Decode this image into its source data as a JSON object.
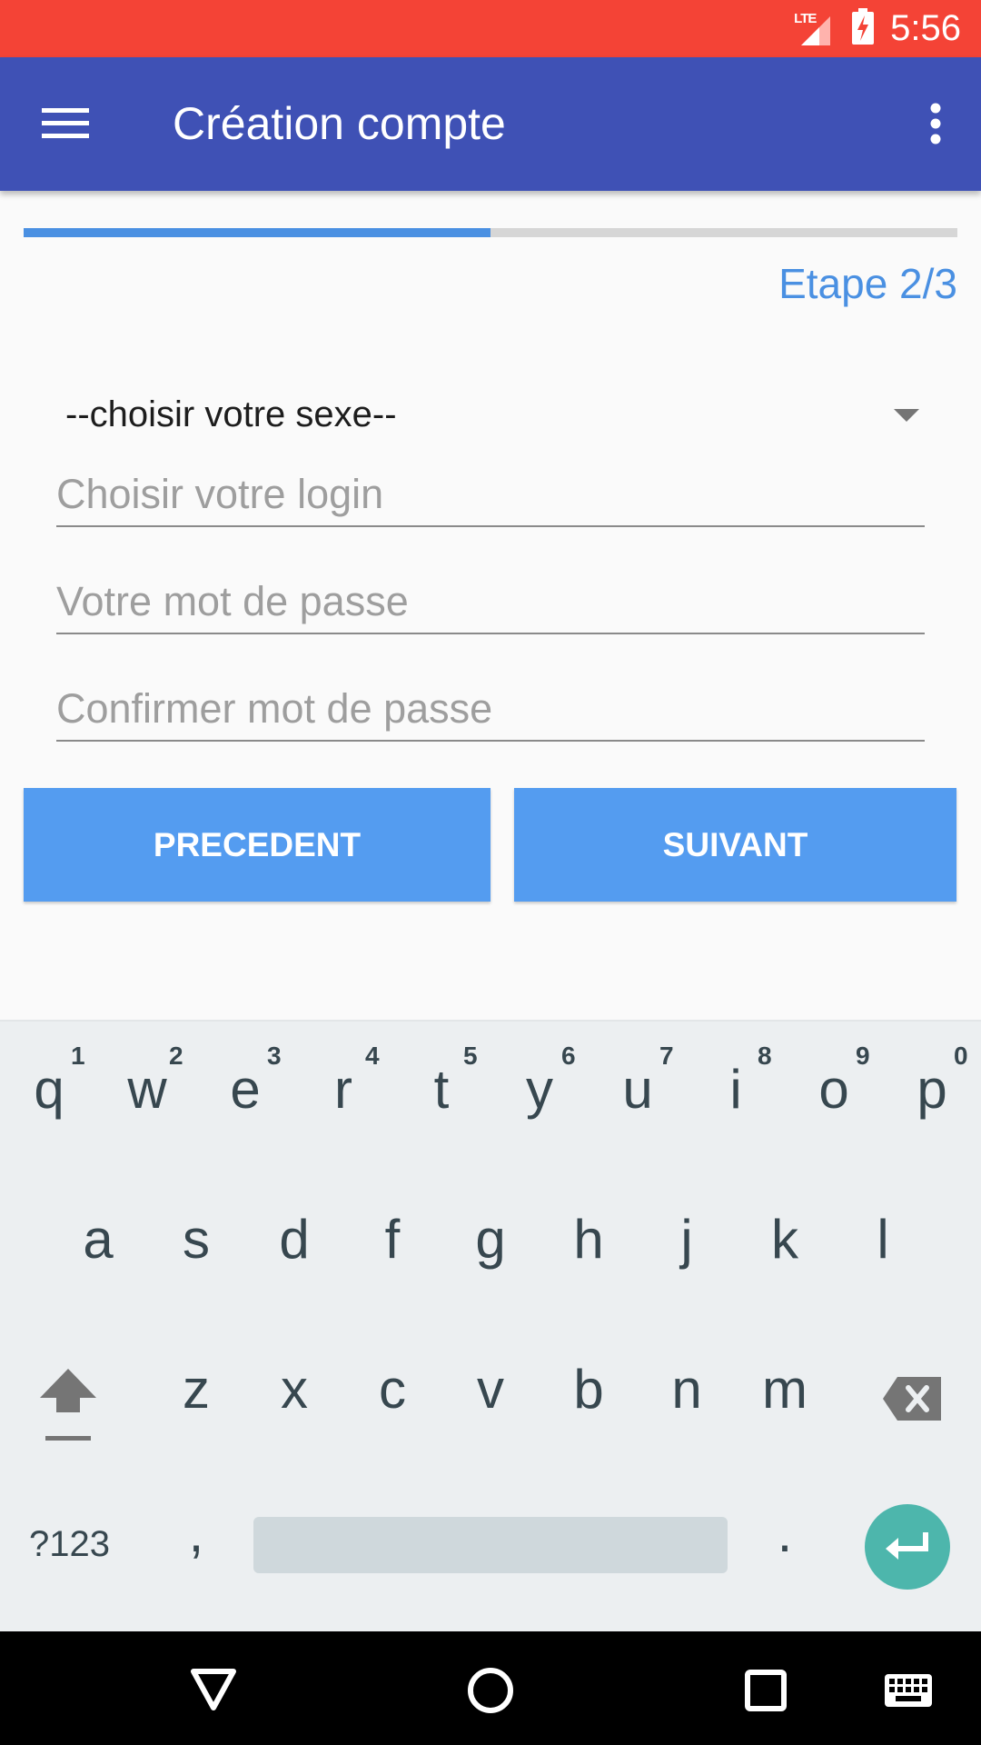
{
  "status_bar": {
    "network": "LTE",
    "time": "5:56"
  },
  "app_bar": {
    "title": "Création compte"
  },
  "progress": {
    "value": 0.5,
    "color": "#4a90e2",
    "track_color": "#d6d6d6"
  },
  "step_label": "Etape 2/3",
  "form": {
    "sex_spinner": {
      "selected": "--choisir votre sexe--"
    },
    "login": {
      "placeholder": "Choisir votre login",
      "value": ""
    },
    "password": {
      "placeholder": "Votre mot de passe",
      "value": ""
    },
    "confirm_password": {
      "placeholder": "Confirmer mot de passe",
      "value": ""
    }
  },
  "buttons": {
    "previous": "PRECEDENT",
    "next": "SUIVANT",
    "color": "#549cf0"
  },
  "keyboard": {
    "row1": [
      "q",
      "w",
      "e",
      "r",
      "t",
      "y",
      "u",
      "i",
      "o",
      "p"
    ],
    "row1_hints": [
      "1",
      "2",
      "3",
      "4",
      "5",
      "6",
      "7",
      "8",
      "9",
      "0"
    ],
    "row2": [
      "a",
      "s",
      "d",
      "f",
      "g",
      "h",
      "j",
      "k",
      "l"
    ],
    "row3": [
      "z",
      "x",
      "c",
      "v",
      "b",
      "n",
      "m"
    ],
    "symbols_key": "?123",
    "comma_key": ",",
    "period_key": ".",
    "icons": {
      "shift": "shift-icon",
      "backspace": "backspace-icon",
      "enter": "enter-icon",
      "accent": "#4db6ac"
    }
  },
  "colors": {
    "status_bar": "#f44336",
    "app_bar": "#3f51b5",
    "accent": "#4a90e2"
  }
}
